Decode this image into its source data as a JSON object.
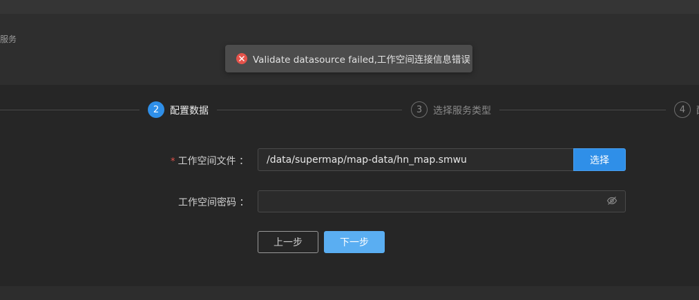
{
  "breadcrumb": {
    "text": "服务"
  },
  "toast": {
    "message": "Validate datasource failed,工作空间连接信息错误",
    "icon": "error-circle-icon",
    "icon_color": "#e5534b"
  },
  "steps": [
    {
      "number": "2",
      "label": "配置数据",
      "state": "active"
    },
    {
      "number": "3",
      "label": "选择服务类型",
      "state": "pending"
    },
    {
      "number": "4",
      "label": "配",
      "state": "pending"
    }
  ],
  "form": {
    "workspace_file": {
      "label": "工作空间文件 ：",
      "required_mark": "*",
      "value": "/data/supermap/map-data/hn_map.smwu",
      "choose_label": "选择"
    },
    "workspace_password": {
      "label": "工作空间密码 ：",
      "value": "",
      "toggle_icon": "eye-off-icon"
    }
  },
  "actions": {
    "prev_label": "上一步",
    "next_label": "下一步"
  },
  "colors": {
    "accent": "#2f8fe8",
    "next_button": "#5aaef2",
    "error": "#e5534b"
  }
}
